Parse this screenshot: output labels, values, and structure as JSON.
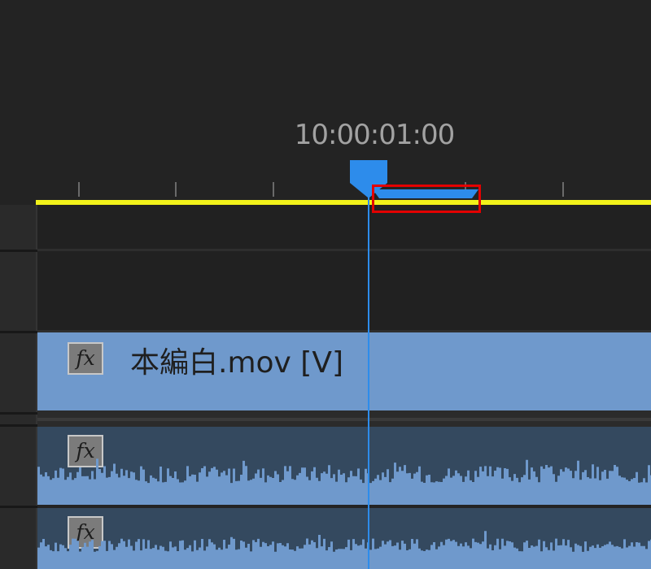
{
  "timeline": {
    "timecode": "10:00:01:00",
    "colors": {
      "background": "#232323",
      "work_area_bar": "#f2f21a",
      "playhead": "#2d8ceb",
      "video_clip": "#6f99cc",
      "audio_clip": "#34495f",
      "audio_waveform": "#6f99cc",
      "highlight": "#e30000"
    },
    "fx_badge": "fx",
    "video_track": {
      "clip_name": "本編白.mov [V]"
    },
    "audio_tracks": [
      {
        "fx_label": "fx",
        "waveform_icon": "waveform"
      },
      {
        "fx_label": "fx",
        "waveform_icon": "waveform"
      }
    ]
  }
}
